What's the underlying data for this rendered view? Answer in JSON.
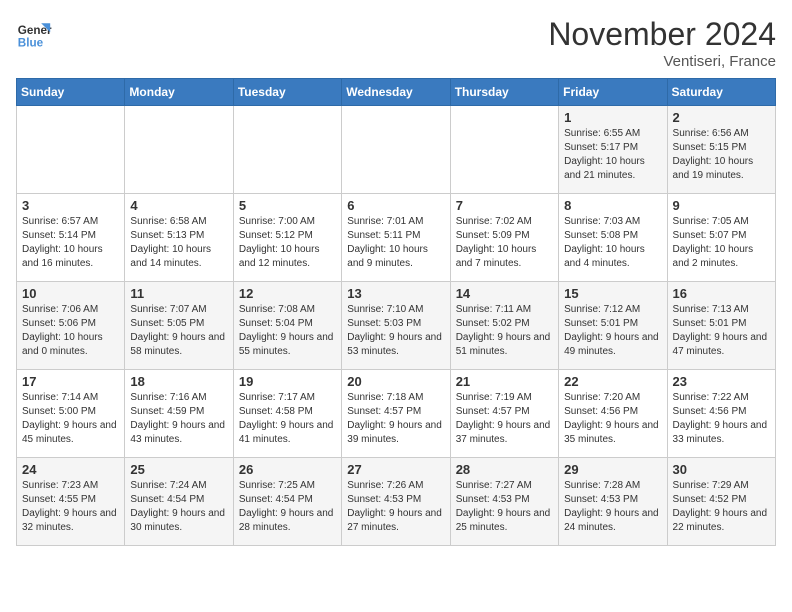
{
  "header": {
    "logo_line1": "General",
    "logo_line2": "Blue",
    "month_title": "November 2024",
    "location": "Ventiseri, France"
  },
  "weekdays": [
    "Sunday",
    "Monday",
    "Tuesday",
    "Wednesday",
    "Thursday",
    "Friday",
    "Saturday"
  ],
  "weeks": [
    [
      {
        "day": "",
        "info": ""
      },
      {
        "day": "",
        "info": ""
      },
      {
        "day": "",
        "info": ""
      },
      {
        "day": "",
        "info": ""
      },
      {
        "day": "",
        "info": ""
      },
      {
        "day": "1",
        "info": "Sunrise: 6:55 AM\nSunset: 5:17 PM\nDaylight: 10 hours\nand 21 minutes."
      },
      {
        "day": "2",
        "info": "Sunrise: 6:56 AM\nSunset: 5:15 PM\nDaylight: 10 hours\nand 19 minutes."
      }
    ],
    [
      {
        "day": "3",
        "info": "Sunrise: 6:57 AM\nSunset: 5:14 PM\nDaylight: 10 hours\nand 16 minutes."
      },
      {
        "day": "4",
        "info": "Sunrise: 6:58 AM\nSunset: 5:13 PM\nDaylight: 10 hours\nand 14 minutes."
      },
      {
        "day": "5",
        "info": "Sunrise: 7:00 AM\nSunset: 5:12 PM\nDaylight: 10 hours\nand 12 minutes."
      },
      {
        "day": "6",
        "info": "Sunrise: 7:01 AM\nSunset: 5:11 PM\nDaylight: 10 hours\nand 9 minutes."
      },
      {
        "day": "7",
        "info": "Sunrise: 7:02 AM\nSunset: 5:09 PM\nDaylight: 10 hours\nand 7 minutes."
      },
      {
        "day": "8",
        "info": "Sunrise: 7:03 AM\nSunset: 5:08 PM\nDaylight: 10 hours\nand 4 minutes."
      },
      {
        "day": "9",
        "info": "Sunrise: 7:05 AM\nSunset: 5:07 PM\nDaylight: 10 hours\nand 2 minutes."
      }
    ],
    [
      {
        "day": "10",
        "info": "Sunrise: 7:06 AM\nSunset: 5:06 PM\nDaylight: 10 hours\nand 0 minutes."
      },
      {
        "day": "11",
        "info": "Sunrise: 7:07 AM\nSunset: 5:05 PM\nDaylight: 9 hours\nand 58 minutes."
      },
      {
        "day": "12",
        "info": "Sunrise: 7:08 AM\nSunset: 5:04 PM\nDaylight: 9 hours\nand 55 minutes."
      },
      {
        "day": "13",
        "info": "Sunrise: 7:10 AM\nSunset: 5:03 PM\nDaylight: 9 hours\nand 53 minutes."
      },
      {
        "day": "14",
        "info": "Sunrise: 7:11 AM\nSunset: 5:02 PM\nDaylight: 9 hours\nand 51 minutes."
      },
      {
        "day": "15",
        "info": "Sunrise: 7:12 AM\nSunset: 5:01 PM\nDaylight: 9 hours\nand 49 minutes."
      },
      {
        "day": "16",
        "info": "Sunrise: 7:13 AM\nSunset: 5:01 PM\nDaylight: 9 hours\nand 47 minutes."
      }
    ],
    [
      {
        "day": "17",
        "info": "Sunrise: 7:14 AM\nSunset: 5:00 PM\nDaylight: 9 hours\nand 45 minutes."
      },
      {
        "day": "18",
        "info": "Sunrise: 7:16 AM\nSunset: 4:59 PM\nDaylight: 9 hours\nand 43 minutes."
      },
      {
        "day": "19",
        "info": "Sunrise: 7:17 AM\nSunset: 4:58 PM\nDaylight: 9 hours\nand 41 minutes."
      },
      {
        "day": "20",
        "info": "Sunrise: 7:18 AM\nSunset: 4:57 PM\nDaylight: 9 hours\nand 39 minutes."
      },
      {
        "day": "21",
        "info": "Sunrise: 7:19 AM\nSunset: 4:57 PM\nDaylight: 9 hours\nand 37 minutes."
      },
      {
        "day": "22",
        "info": "Sunrise: 7:20 AM\nSunset: 4:56 PM\nDaylight: 9 hours\nand 35 minutes."
      },
      {
        "day": "23",
        "info": "Sunrise: 7:22 AM\nSunset: 4:56 PM\nDaylight: 9 hours\nand 33 minutes."
      }
    ],
    [
      {
        "day": "24",
        "info": "Sunrise: 7:23 AM\nSunset: 4:55 PM\nDaylight: 9 hours\nand 32 minutes."
      },
      {
        "day": "25",
        "info": "Sunrise: 7:24 AM\nSunset: 4:54 PM\nDaylight: 9 hours\nand 30 minutes."
      },
      {
        "day": "26",
        "info": "Sunrise: 7:25 AM\nSunset: 4:54 PM\nDaylight: 9 hours\nand 28 minutes."
      },
      {
        "day": "27",
        "info": "Sunrise: 7:26 AM\nSunset: 4:53 PM\nDaylight: 9 hours\nand 27 minutes."
      },
      {
        "day": "28",
        "info": "Sunrise: 7:27 AM\nSunset: 4:53 PM\nDaylight: 9 hours\nand 25 minutes."
      },
      {
        "day": "29",
        "info": "Sunrise: 7:28 AM\nSunset: 4:53 PM\nDaylight: 9 hours\nand 24 minutes."
      },
      {
        "day": "30",
        "info": "Sunrise: 7:29 AM\nSunset: 4:52 PM\nDaylight: 9 hours\nand 22 minutes."
      }
    ]
  ]
}
